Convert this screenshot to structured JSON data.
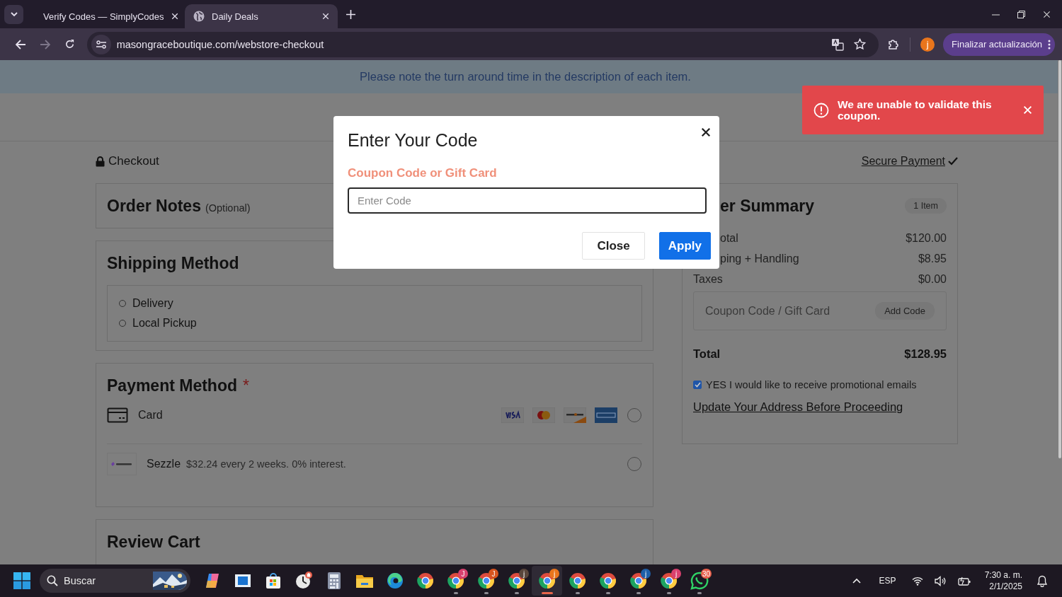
{
  "browser": {
    "tabs": [
      {
        "kind": "check",
        "title": "Verify Codes — SimplyCodes",
        "selected": false
      },
      {
        "kind": "globe",
        "title": "Daily Deals",
        "selected": true
      }
    ],
    "url": "masongraceboutique.com/webstore-checkout",
    "profile": "j",
    "update_button": "Finalizar actualización"
  },
  "page": {
    "banner": "Please note the turn around time in the description of each item.",
    "checkout": "Checkout",
    "secure_payment": "Secure Payment",
    "order_notes": {
      "title": "Order Notes",
      "optional": "(Optional)"
    },
    "shipping": {
      "title": "Shipping Method",
      "options": [
        {
          "label": "Delivery",
          "selected": false
        },
        {
          "label": "Local Pickup",
          "selected": false
        }
      ]
    },
    "payment": {
      "title": "Payment Method",
      "required": "*",
      "options": [
        {
          "kind": "card",
          "label": "Card",
          "selected": false
        },
        {
          "kind": "sezzle",
          "label": "Sezzle",
          "note": "$32.24 every 2 weeks. 0% interest.",
          "selected": false
        }
      ]
    },
    "review": {
      "title": "Review Cart"
    },
    "summary": {
      "title": "er Summary",
      "count": "1 Item",
      "rows": [
        {
          "label": "otal",
          "value": "$120.00",
          "covered": true
        },
        {
          "label": "ping + Handling",
          "value": "$8.95",
          "covered": true
        },
        {
          "label": "Taxes",
          "value": "$0.00",
          "covered": false
        }
      ],
      "coupon_placeholder": "Coupon Code / Gift Card",
      "add_code": "Add Code",
      "total_label": "Total",
      "total": "$128.95",
      "promo": {
        "label": "YES I would like to receive promotional emails",
        "checked": true
      },
      "update_link": "Update Your Address Before Proceeding"
    }
  },
  "modal": {
    "title": "Enter Your Code",
    "label": "Coupon Code or Gift Card",
    "placeholder": "Enter Code",
    "buttons": [
      {
        "kind": "secondary",
        "label": "Close"
      },
      {
        "kind": "primary",
        "label": "Apply"
      }
    ]
  },
  "toast": {
    "message": "We are unable to validate this coupon."
  },
  "taskbar": {
    "search": "Buscar",
    "apps": [
      {
        "kind": "copilot",
        "running": false,
        "selected": false
      },
      {
        "kind": "window",
        "running": false,
        "selected": false
      },
      {
        "kind": "store",
        "running": false,
        "selected": false
      },
      {
        "kind": "clock",
        "running": false,
        "selected": false
      },
      {
        "kind": "calculator",
        "running": false,
        "selected": false
      },
      {
        "kind": "folder",
        "running": false,
        "selected": false
      },
      {
        "kind": "edge",
        "running": false,
        "selected": false
      },
      {
        "kind": "chrome",
        "running": false,
        "selected": false
      },
      {
        "kind": "chrome",
        "badge": "J",
        "color": "#d9406e",
        "running": true,
        "selected": false
      },
      {
        "kind": "chrome",
        "badge": "J",
        "color": "#d9541e",
        "running": true,
        "selected": false
      },
      {
        "kind": "chrome",
        "badge": "j",
        "color": "#5a463c",
        "running": true,
        "selected": false
      },
      {
        "kind": "chrome",
        "badge": "j",
        "color": "#e9751c",
        "running": true,
        "selected": true
      },
      {
        "kind": "chrome",
        "running": true,
        "selected": false
      },
      {
        "kind": "chrome",
        "running": true,
        "selected": false
      },
      {
        "kind": "chrome",
        "badge": "j",
        "color": "#1f5fa8",
        "running": true,
        "selected": false
      },
      {
        "kind": "chrome",
        "badge": "j",
        "color": "#d9406e",
        "running": true,
        "selected": false
      },
      {
        "kind": "whatsapp",
        "badge": "30",
        "color": "#e8604c",
        "running": true,
        "selected": false
      }
    ],
    "language": "ESP",
    "time": "7:30 a. m.",
    "date": "2/1/2025"
  }
}
